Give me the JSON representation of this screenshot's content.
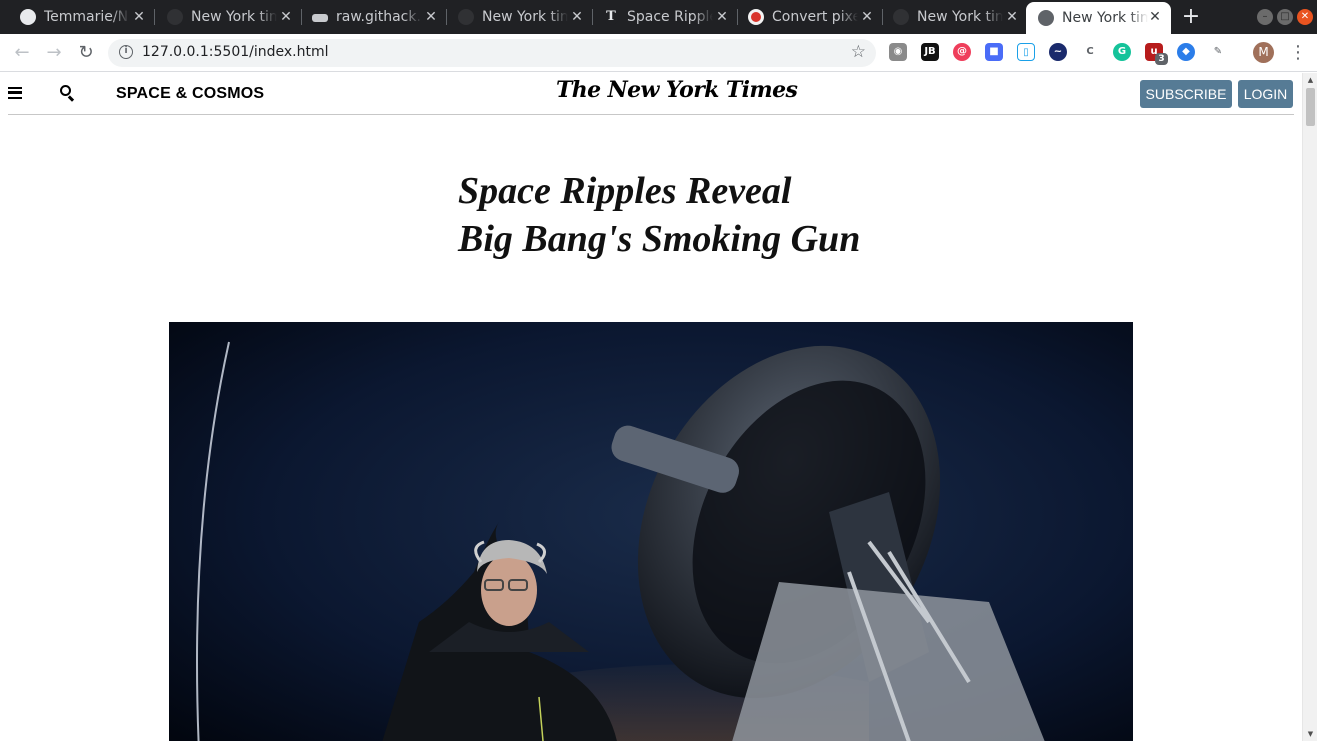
{
  "browser": {
    "tabs": [
      {
        "title": "Temmarie/N",
        "icon": "github-icon"
      },
      {
        "title": "New York tim",
        "icon": "github-icon"
      },
      {
        "title": "raw.githack.",
        "icon": "githack-icon"
      },
      {
        "title": "New York tim",
        "icon": "github-icon"
      },
      {
        "title": "Space Ripple",
        "icon": "nyt-icon"
      },
      {
        "title": "Convert pixe",
        "icon": "converter-icon"
      },
      {
        "title": "New York tim",
        "icon": "github-icon"
      },
      {
        "title": "New York tim",
        "icon": "globe-icon"
      }
    ],
    "url": "127.0.0.1:5501/index.html",
    "profile_initial": "M",
    "extension_badge": "3"
  },
  "site": {
    "section": "SPACE & COSMOS",
    "masthead": "The New York Times",
    "subscribe_label": "SUBSCRIBE",
    "login_label": "LOGIN",
    "accent_color": "#567b95"
  },
  "article": {
    "headline_line1": "Space Ripples Reveal",
    "headline_line2": "Big Bang's Smoking Gun"
  }
}
